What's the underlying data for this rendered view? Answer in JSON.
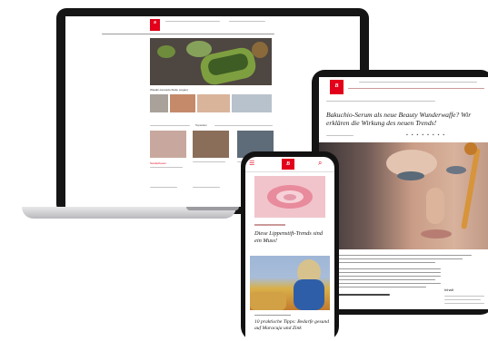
{
  "brand": {
    "logo_text": "Bild der Frau",
    "accent": "#e2001a"
  },
  "laptop": {
    "hero_caption": "Wasabi-Avocado-Stulle (vegan)",
    "section_title": "Topseiten",
    "card1_title": "Sonderboxen"
  },
  "tablet": {
    "article_title": "Bakuchio-Serum als neue Beauty Wunderwaffe? Wir erklären die Wirkung des neuen Trends!",
    "sidebar_label": "Inhalt"
  },
  "phone": {
    "article1_title": "Diese Lippenstift-Trends sind ein Muss!",
    "article2_title": "10 praktische Tipps: Bedarfe gesund auf Maracuja und Zink"
  },
  "colors": {
    "frame": "#151515",
    "base": "#c9c9cc",
    "text_dark": "#222222"
  }
}
